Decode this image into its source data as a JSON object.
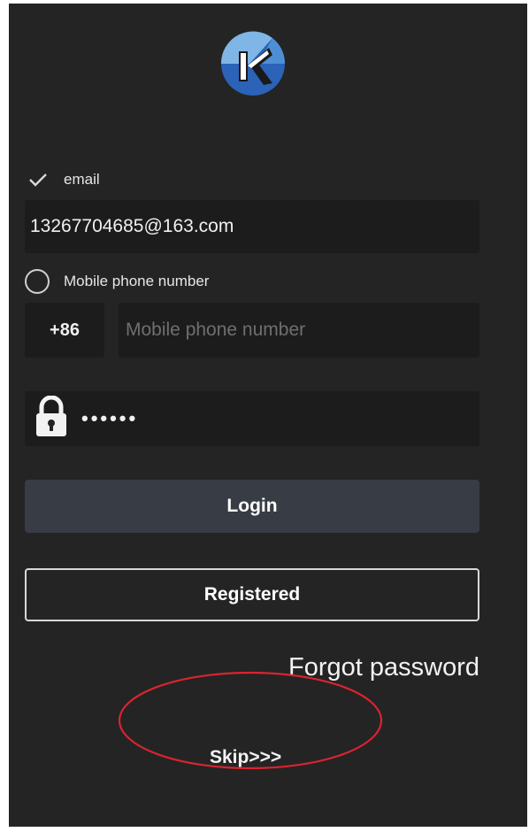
{
  "login_form": {
    "email_option_label": "email",
    "email_value": "13267704685@163.com",
    "phone_option_label": "Mobile phone number",
    "country_code": "+86",
    "phone_placeholder": "Mobile phone number",
    "password_mask": "••••••",
    "login_label": "Login",
    "register_label": "Registered",
    "forgot_password_label": "Forgot password",
    "skip_label": "Skip>>>",
    "selected_method": "email"
  },
  "icons": {
    "logo": "k-logo-icon",
    "email_check": "check-icon",
    "password": "lock-icon"
  },
  "colors": {
    "background": "#242424",
    "field": "#1c1c1c",
    "login_button": "#383c44",
    "logo_light": "#7fb6e6",
    "logo_dark": "#2a63b8",
    "annotation": "#d9242f"
  }
}
